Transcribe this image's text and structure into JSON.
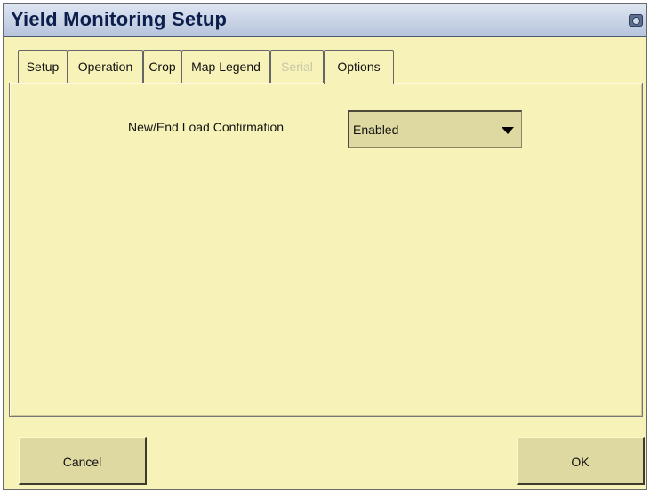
{
  "window": {
    "title": "Yield Monitoring Setup",
    "title_icon": "camera-icon"
  },
  "tabs": [
    {
      "label": "Setup",
      "state": "normal"
    },
    {
      "label": "Operation",
      "state": "normal"
    },
    {
      "label": "Crop",
      "state": "normal"
    },
    {
      "label": "Map Legend",
      "state": "normal"
    },
    {
      "label": "Serial",
      "state": "disabled"
    },
    {
      "label": "Options",
      "state": "active"
    }
  ],
  "options": {
    "load_confirmation": {
      "label": "New/End Load Confirmation",
      "value": "Enabled"
    }
  },
  "buttons": {
    "cancel": "Cancel",
    "ok": "OK"
  },
  "colors": {
    "background": "#f7f3b8",
    "titlebar": "#b7c4dc",
    "title_text": "#0c1f4c",
    "button": "#ded9a0"
  }
}
